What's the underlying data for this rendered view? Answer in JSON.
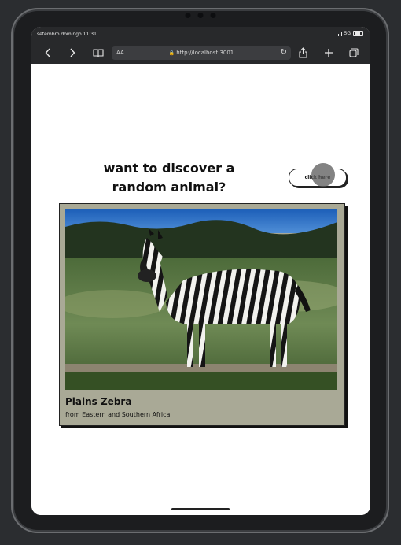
{
  "status": {
    "time": "setembro domingo 11:31",
    "network": "5G"
  },
  "browser": {
    "text_size_label": "AA",
    "url": "http://localhost:3001",
    "icons": [
      "chevron-left-icon",
      "chevron-right-icon",
      "book-icon",
      "lock-icon",
      "reload-icon",
      "share-icon",
      "plus-icon",
      "tabs-icon"
    ]
  },
  "page": {
    "headline": "want to discover a random animal?",
    "button_label": "click here",
    "animal": {
      "name": "Plains Zebra",
      "origin": "from Eastern and Southern Africa"
    }
  },
  "colors": {
    "card_background": "#a9a996",
    "toolbar_background": "#28292b"
  }
}
